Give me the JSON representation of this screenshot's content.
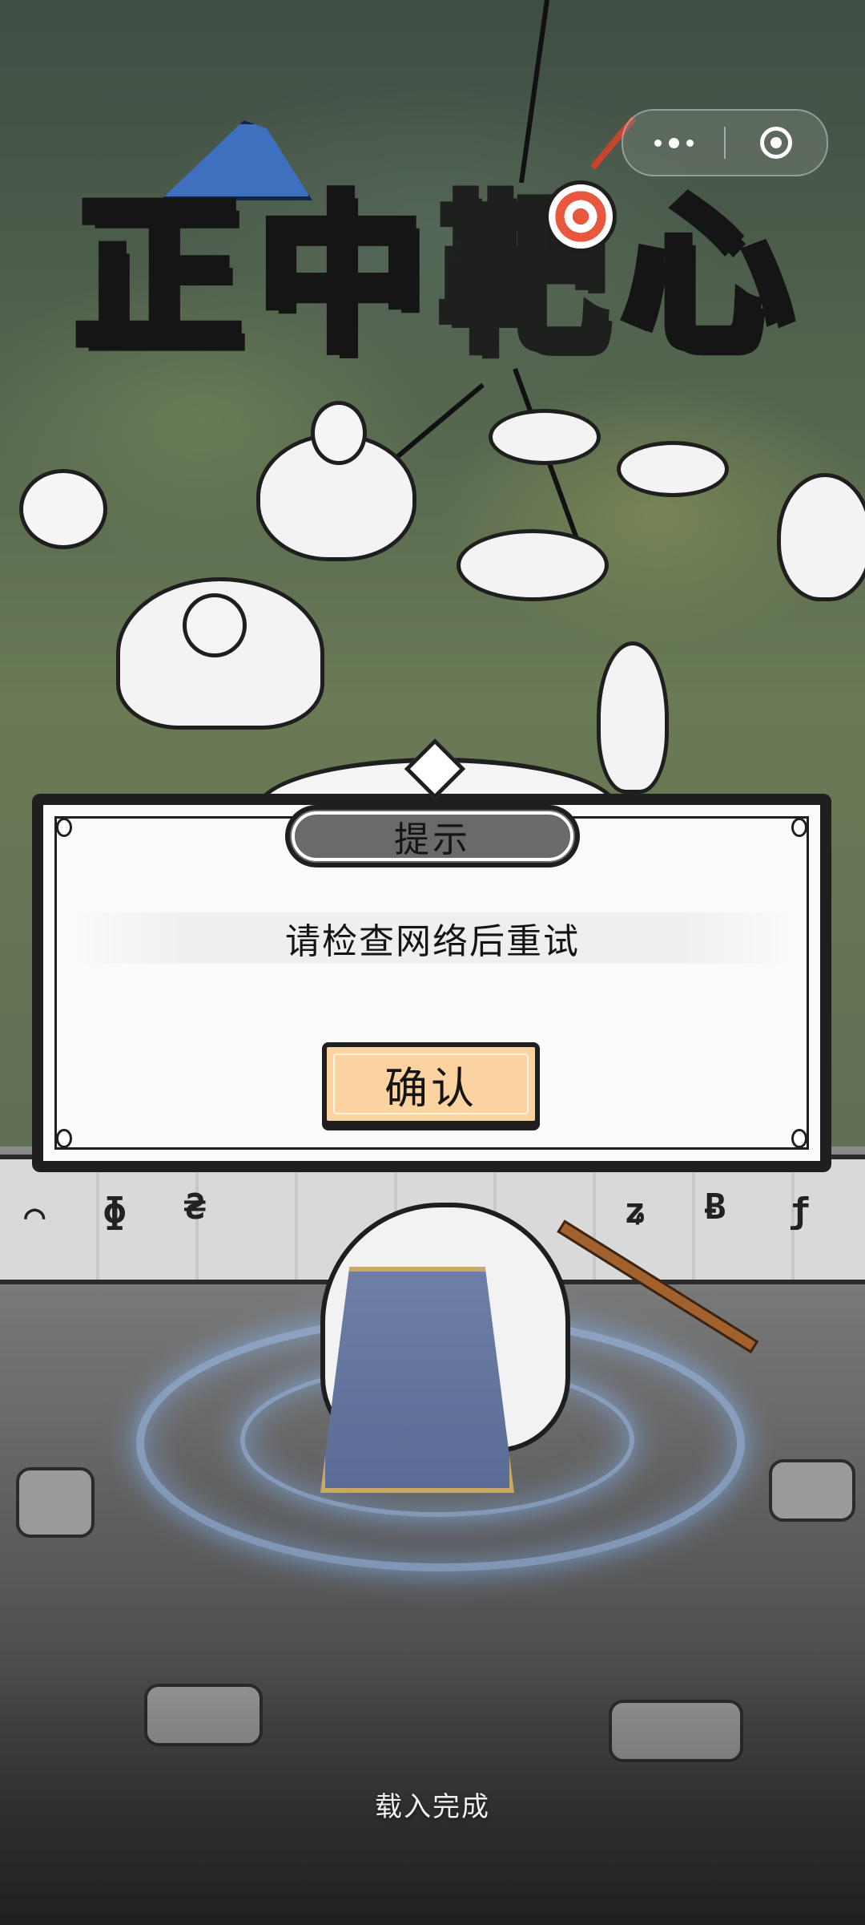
{
  "game_title": {
    "chars": [
      "正",
      "中",
      "靶",
      "心"
    ]
  },
  "capsule": {
    "more_icon": "more-dots-icon",
    "close_icon": "target-circle-icon"
  },
  "dialog": {
    "title": "提示",
    "message": "请检查网络后重试",
    "confirm_label": "确认"
  },
  "status": {
    "loading_text": "载入完成"
  },
  "colors": {
    "confirm_button": "#fbd3a1",
    "title_pill": "#6a6a6a",
    "hat_blue": "#3f6fbf",
    "cloak_blue": "#6d7fa6"
  }
}
